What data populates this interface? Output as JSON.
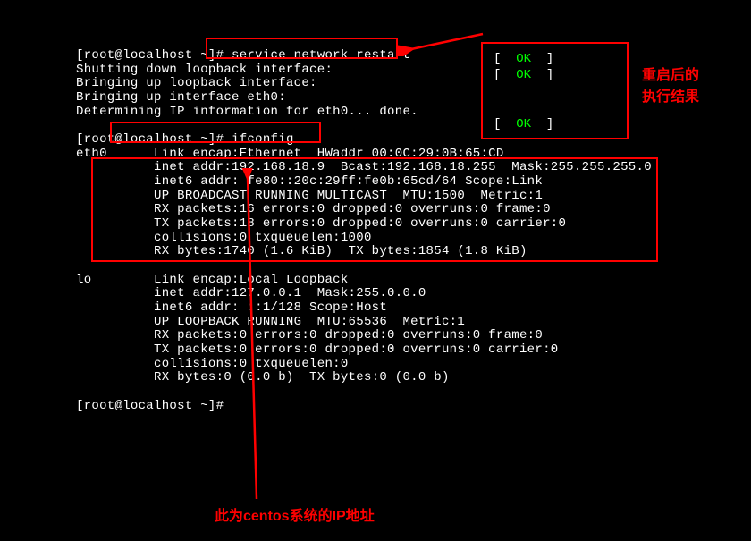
{
  "prompt1": "[root@localhost ~]# ",
  "cmd1": "service network restart",
  "line1": "Shutting down loopback interface:",
  "line2": "Bringing up loopback interface:",
  "line3": "Bringing up interface eth0:",
  "line4": "Determining IP information for eth0... done.",
  "prompt2": "[root@localhost ~]# ",
  "cmd2": "ifconfig",
  "eth0_label": "eth0",
  "eth0_l1": "      Link encap:Ethernet  HWaddr 00:0C:29:0B:65:CD",
  "eth0_l2": "          inet addr:192.168.18.9  Bcast:192.168.18.255  Mask:255.255.255.0",
  "eth0_l3": "          inet6 addr: fe80::20c:29ff:fe0b:65cd/64 Scope:Link",
  "eth0_l4": "          UP BROADCAST RUNNING MULTICAST  MTU:1500  Metric:1",
  "eth0_l5": "          RX packets:16 errors:0 dropped:0 overruns:0 frame:0",
  "eth0_l6": "          TX packets:18 errors:0 dropped:0 overruns:0 carrier:0",
  "eth0_l7": "          collisions:0 txqueuelen:1000",
  "eth0_l8": "          RX bytes:1740 (1.6 KiB)  TX bytes:1854 (1.8 KiB)",
  "lo_label": "lo",
  "lo_l1": "        Link encap:Local Loopback",
  "lo_l2": "          inet addr:127.0.0.1  Mask:255.0.0.0",
  "lo_l3": "          inet6 addr: ::1/128 Scope:Host",
  "lo_l4": "          UP LOOPBACK RUNNING  MTU:65536  Metric:1",
  "lo_l5": "          RX packets:0 errors:0 dropped:0 overruns:0 frame:0",
  "lo_l6": "          TX packets:0 errors:0 dropped:0 overruns:0 carrier:0",
  "lo_l7": "          collisions:0 txqueuelen:0",
  "lo_l8": "          RX bytes:0 (0.0 b)  TX bytes:0 (0.0 b)",
  "prompt3": "[root@localhost ~]# ",
  "ok_bracket_l": "[  ",
  "ok_text": "OK",
  "ok_bracket_r": "  ]",
  "annotation1_l1": "重启后的",
  "annotation1_l2": "执行结果",
  "annotation2": "此为centos系统的IP地址"
}
